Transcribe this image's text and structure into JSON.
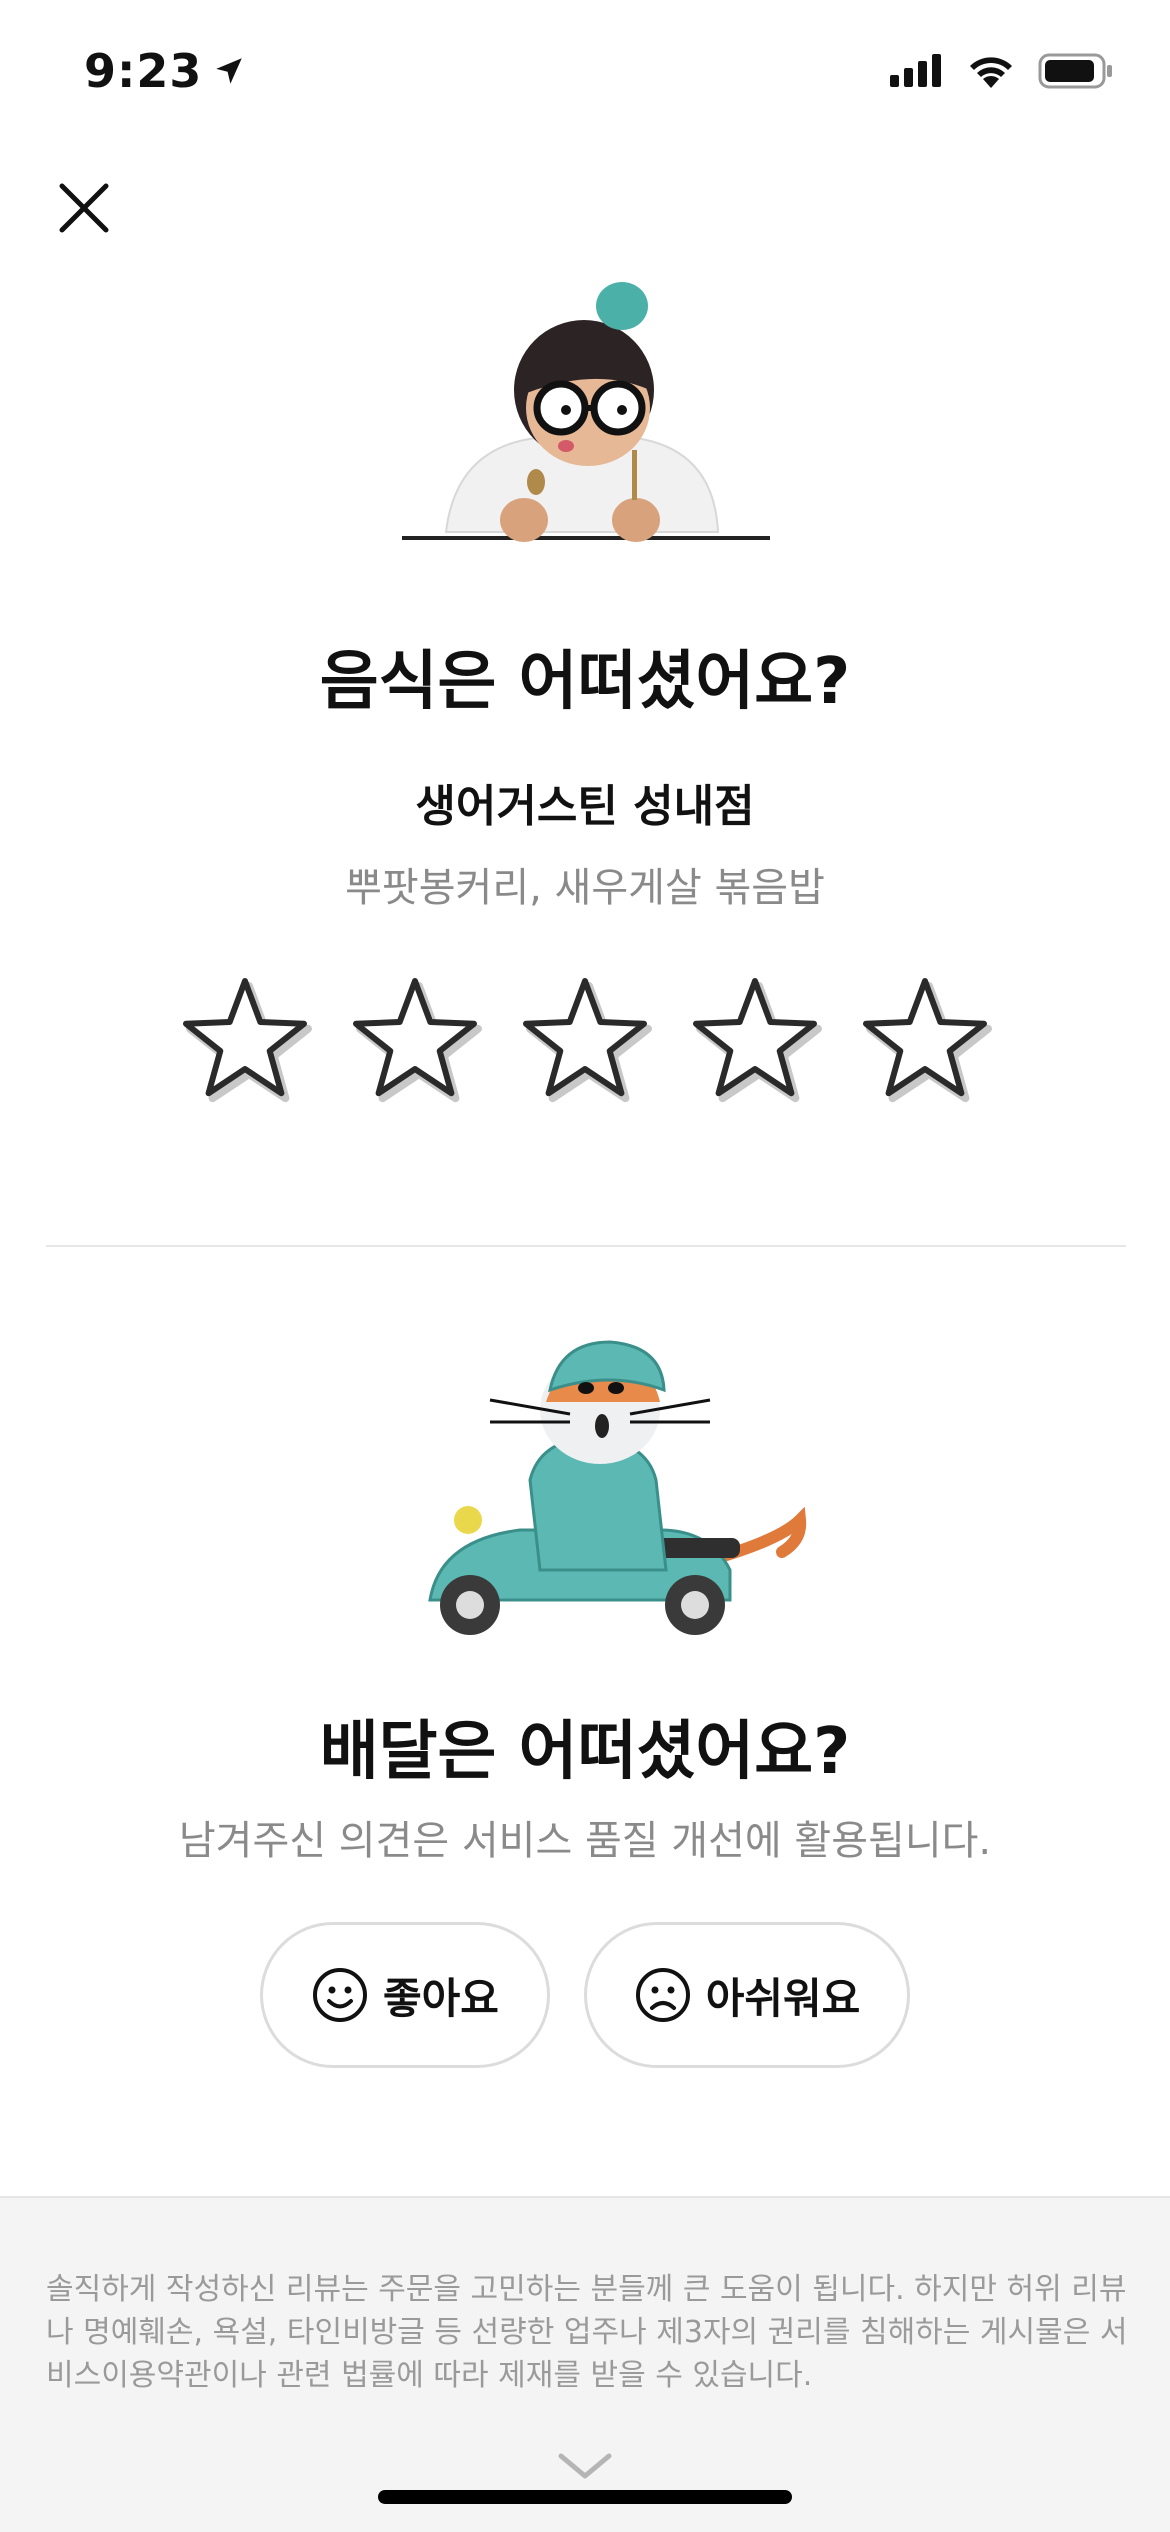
{
  "status_bar": {
    "time": "9:23",
    "battery_level": 0.9
  },
  "food_section": {
    "title": "음식은 어떠셨어요?",
    "store_name": "생어거스틴 성내점",
    "menu_items": "뿌팟봉커리, 새우게살 볶음밥",
    "rating": {
      "max": 5,
      "selected": 0
    }
  },
  "delivery_section": {
    "title": "배달은 어떠셨어요?",
    "subtitle": "남겨주신 의견은 서비스 품질 개선에 활용됩니다.",
    "good_label": "좋아요",
    "bad_label": "아쉬워요"
  },
  "footer": {
    "notice": "솔직하게 작성하신 리뷰는 주문을 고민하는 분들께 큰 도움이 됩니다. 하지만 허위 리뷰나 명예훼손, 욕설, 타인비방글 등 선량한 업주나 제3자의 권리를 침해하는 게시물은 서비스이용약관이나 관련 법률에 따라 제재를 받을 수 있습니다."
  }
}
